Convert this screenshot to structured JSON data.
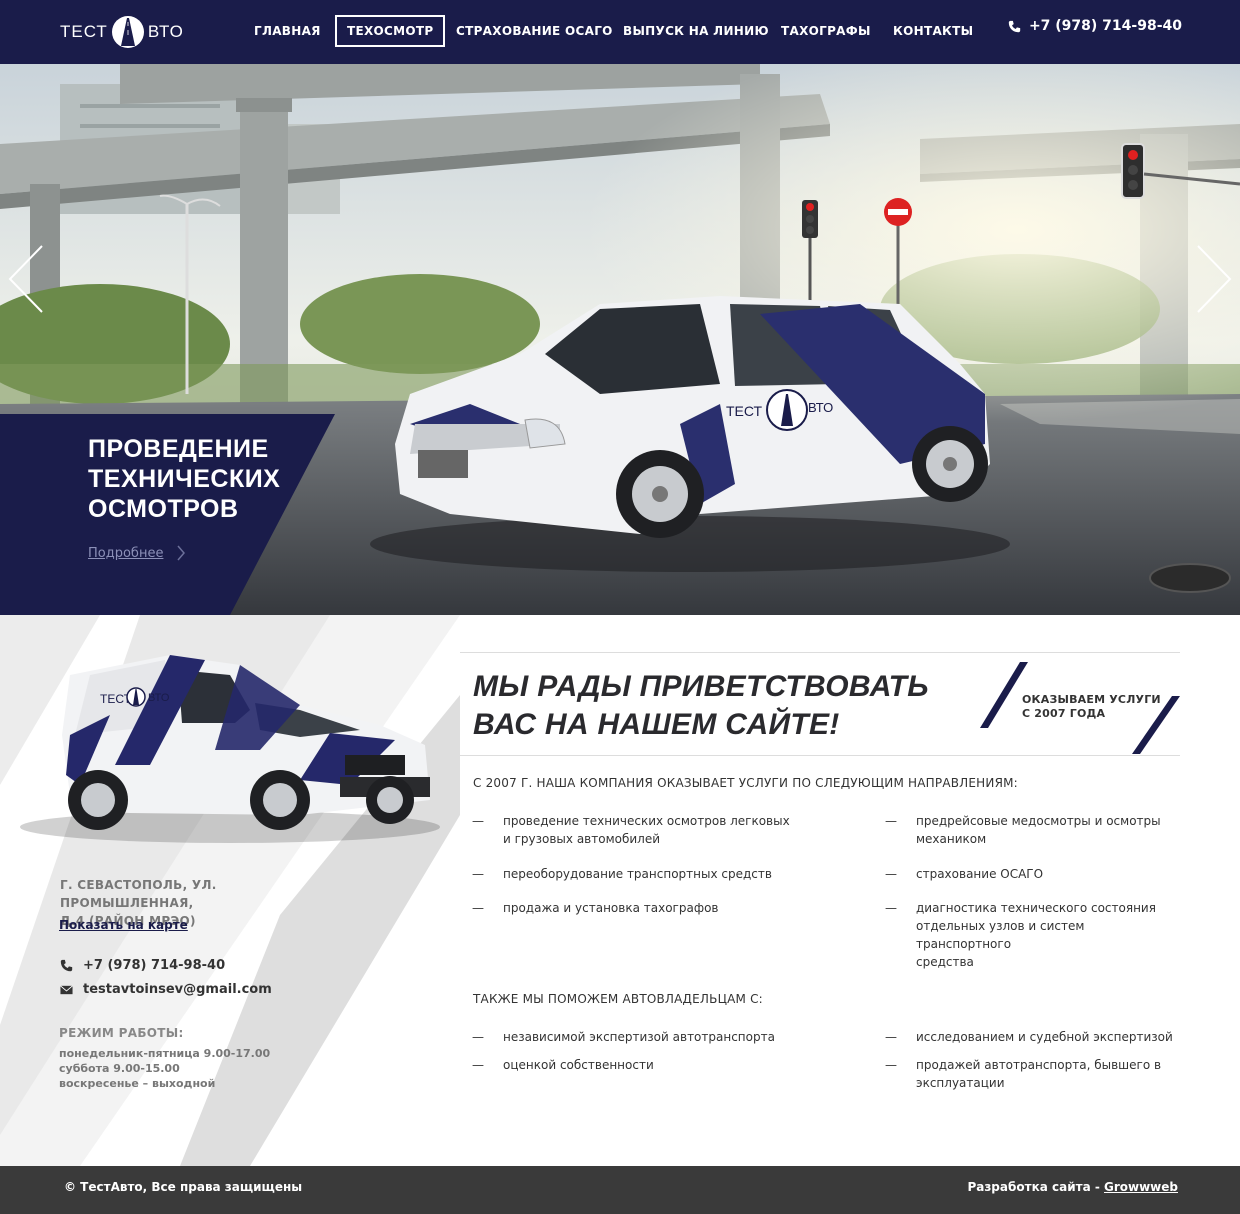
{
  "header": {
    "logo_left": "ТЕСТ",
    "logo_right": "ВТО",
    "nav": [
      {
        "label": "ГЛАВНАЯ"
      },
      {
        "label": "ТЕХОСМОТР"
      },
      {
        "label": "СТРАХОВАНИЕ ОСАГО"
      },
      {
        "label": "ВЫПУСК НА ЛИНИЮ"
      },
      {
        "label": "ТАХОГРАФЫ"
      },
      {
        "label": "КОНТАКТЫ"
      }
    ],
    "active_nav": "ТЕХОСМОТР",
    "phone": "+7 (978) 714-98-40",
    "phone_icon": "phone-icon"
  },
  "hero": {
    "title_line1": "ПРОВЕДЕНИЕ",
    "title_line2": "ТЕХНИЧЕСКИХ",
    "title_line3": "ОСМОТРОВ",
    "more_label": "Подробнее",
    "car_logo_left": "ТЕСТ",
    "car_logo_right": "ВТО",
    "prev_icon": "chevron-left-icon",
    "next_icon": "chevron-right-icon"
  },
  "sidebar": {
    "van_logo_left": "ТЕСТ",
    "van_logo_right": "ВТО",
    "address_line1": "Г. СЕВАСТОПОЛЬ, УЛ. ПРОМЫШЛЕННАЯ,",
    "address_line2": "Д.4 (РАЙОН МРЭО)",
    "map_link": "Показать на карте",
    "phone": "+7 (978) 714-98-40",
    "email": "testavtoinsev@gmail.com",
    "hours_title": "РЕЖИМ РАБОТЫ:",
    "hours": [
      "понедельник-пятница 9.00-17.00",
      "суббота 9.00-15.00",
      "воскресенье – выходной"
    ]
  },
  "main": {
    "welcome_line1": "МЫ РАДЫ ПРИВЕТСТВОВАТЬ",
    "welcome_line2": "ВАС НА НАШЕМ САЙТЕ!",
    "since_line1": "ОКАЗЫВАЕМ УСЛУГИ",
    "since_line2": "С 2007 ГОДА",
    "services_heading": "С 2007 Г. НАША КОМПАНИЯ ОКАЗЫВАЕТ УСЛУГИ ПО СЛЕДУЮЩИМ НАПРАВЛЕНИЯМ:",
    "services_left": [
      [
        "проведение технических осмотров легковых",
        "и грузовых автомобилей"
      ],
      [
        "переоборудование транспортных средств"
      ],
      [
        "продажа и установка тахографов"
      ]
    ],
    "services_right": [
      [
        "предрейсовые медосмотры и осмотры",
        "механиком"
      ],
      [
        "страхование ОСАГО"
      ],
      [
        "диагностика технического состояния",
        "отдельных узлов и систем транспортного",
        "средства"
      ]
    ],
    "help_heading": "ТАКЖЕ МЫ ПОМОЖЕМ АВТОВЛАДЕЛЬЦАМ С:",
    "help_left": [
      [
        "независимой экспертизой автотранспорта"
      ],
      [
        "оценкой собственности"
      ]
    ],
    "help_right": [
      [
        "исследованием и судебной экспертизой"
      ],
      [
        "продажей автотранспорта, бывшего в",
        "эксплуатации"
      ]
    ],
    "dash": "—"
  },
  "footer": {
    "copyright": "© ТестАвто, Все права защищены",
    "dev_label": "Разработка сайта - ",
    "dev_link": "Growwweb"
  },
  "colors": {
    "brand_navy": "#1a1c4a",
    "footer_gray": "#3a3a3a"
  }
}
